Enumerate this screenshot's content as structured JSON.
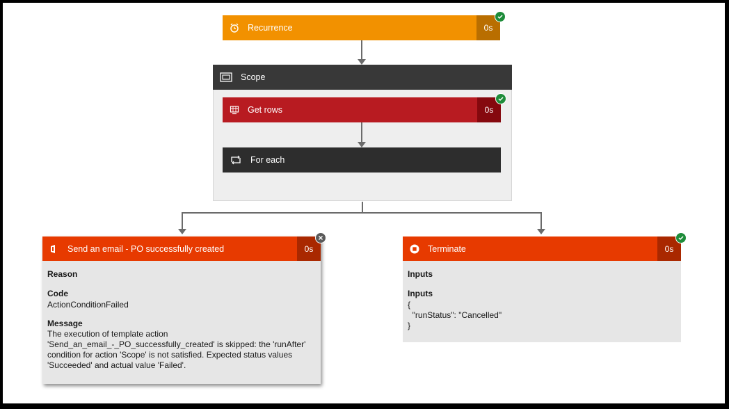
{
  "recurrence": {
    "title": "Recurrence",
    "duration": "0s",
    "color": "#f29100",
    "dur_color": "#b96e00",
    "icon": "alarm-clock-icon",
    "status": "succeeded"
  },
  "scope": {
    "title": "Scope",
    "color": "#383838",
    "icon": "scope-icon",
    "get_rows": {
      "title": "Get rows",
      "duration": "0s",
      "color": "#b81b21",
      "dur_color": "#85090e",
      "icon": "excel-table-icon",
      "status": "succeeded"
    },
    "for_each": {
      "title": "For each",
      "color": "#2d2d2d",
      "icon": "loop-icon"
    }
  },
  "send_email": {
    "title": "Send an email - PO successfully created",
    "duration": "0s",
    "color": "#e73a00",
    "dur_color": "#a92800",
    "icon": "office-icon",
    "status": "skipped",
    "reason_label": "Reason",
    "code_label": "Code",
    "code_value": "ActionConditionFailed",
    "message_label": "Message",
    "message_lines": [
      "The execution of template action",
      "'Send_an_email_-_PO_successfully_created' is skipped: the 'runAfter'",
      "condition for action 'Scope' is not satisfied. Expected status values",
      "'Succeeded' and actual value 'Failed'."
    ]
  },
  "terminate": {
    "title": "Terminate",
    "duration": "0s",
    "color": "#e73a00",
    "dur_color": "#a92800",
    "icon": "stop-icon",
    "status": "succeeded",
    "inputs_header": "Inputs",
    "inputs_label": "Inputs",
    "inputs_lines": [
      "{",
      "  \"runStatus\": \"Cancelled\"",
      "}"
    ]
  }
}
